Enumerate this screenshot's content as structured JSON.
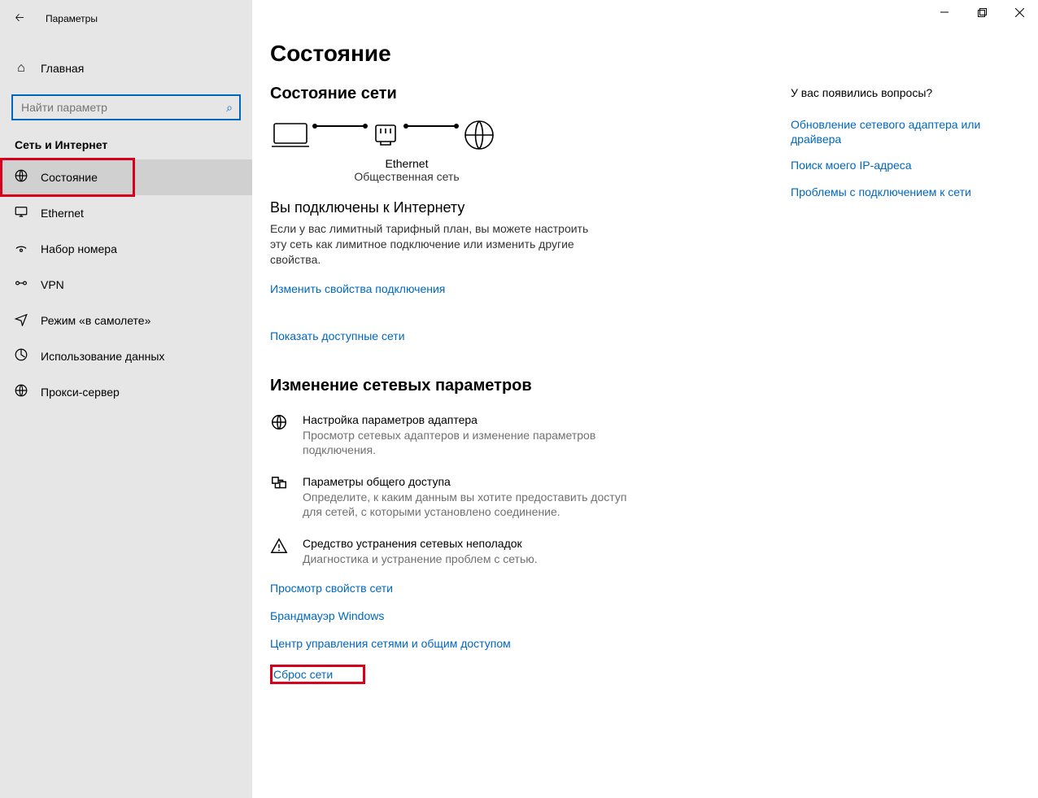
{
  "app": {
    "title": "Параметры"
  },
  "sidebar": {
    "home": "Главная",
    "search_placeholder": "Найти параметр",
    "category": "Сеть и Интернет",
    "items": [
      {
        "label": "Состояние"
      },
      {
        "label": "Ethernet"
      },
      {
        "label": "Набор номера"
      },
      {
        "label": "VPN"
      },
      {
        "label": "Режим «в самолете»"
      },
      {
        "label": "Использование данных"
      },
      {
        "label": "Прокси-сервер"
      }
    ]
  },
  "page": {
    "title": "Состояние",
    "status_heading": "Состояние сети",
    "node_label": "Ethernet",
    "node_sublabel": "Общественная сеть",
    "connected_title": "Вы подключены к Интернету",
    "connected_desc": "Если у вас лимитный тарифный план, вы можете настроить эту сеть как лимитное подключение или изменить другие свойства.",
    "link_change_props": "Изменить свойства подключения",
    "link_show_networks": "Показать доступные сети",
    "change_heading": "Изменение сетевых параметров",
    "rows": [
      {
        "title": "Настройка параметров адаптера",
        "desc": "Просмотр сетевых адаптеров и изменение параметров подключения."
      },
      {
        "title": "Параметры общего доступа",
        "desc": "Определите, к каким данным вы хотите предоставить доступ для сетей, с которыми установлено соединение."
      },
      {
        "title": "Средство устранения сетевых неполадок",
        "desc": "Диагностика и устранение проблем с сетью."
      }
    ],
    "links": [
      "Просмотр свойств сети",
      "Брандмауэр Windows",
      "Центр управления сетями и общим доступом"
    ],
    "reset": "Сброс сети"
  },
  "help": {
    "heading": "У вас появились вопросы?",
    "links": [
      "Обновление сетевого адаптера или драйвера",
      "Поиск моего IP-адреса",
      "Проблемы с подключением к сети"
    ]
  }
}
